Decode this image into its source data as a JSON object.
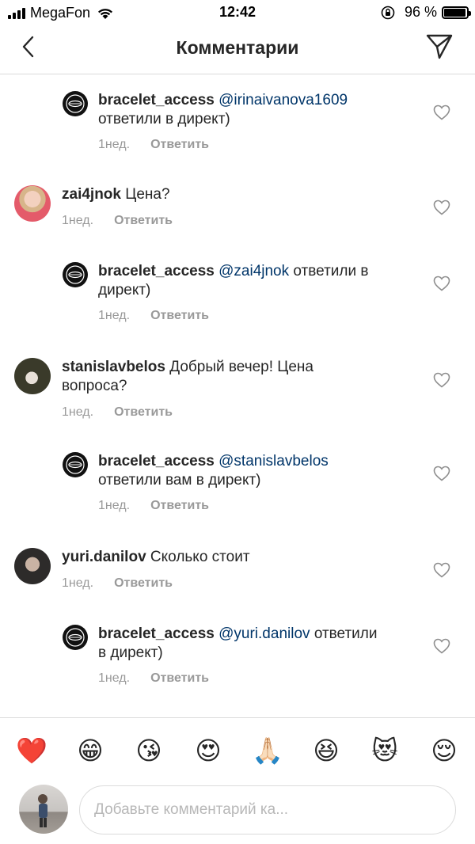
{
  "status_bar": {
    "carrier": "MegaFon",
    "time": "12:42",
    "battery_percent": "96 %",
    "battery_level": 0.96
  },
  "nav": {
    "title": "Комментарии"
  },
  "comments": [
    {
      "username": "bracelet_access",
      "mention": "@irinaivanova1609",
      "text": "ответили в директ)",
      "time": "1нед.",
      "reply_label": "Ответить"
    },
    {
      "username": "zai4jnok",
      "mention": "",
      "text": "Цена?",
      "time": "1нед.",
      "reply_label": "Ответить"
    },
    {
      "username": "bracelet_access",
      "mention": "@zai4jnok",
      "text": "ответили в",
      "text2": "директ)",
      "time": "1нед.",
      "reply_label": "Ответить"
    },
    {
      "username": "stanislavbelos",
      "mention": "",
      "text": "Добрый вечер! Цена",
      "text2": "вопроса?",
      "time": "1нед.",
      "reply_label": "Ответить"
    },
    {
      "username": "bracelet_access",
      "mention": "@stanislavbelos",
      "text": "ответили вам в директ)",
      "time": "1нед.",
      "reply_label": "Ответить"
    },
    {
      "username": "yuri.danilov",
      "mention": "",
      "text": "Сколько стоит",
      "time": "1нед.",
      "reply_label": "Ответить"
    },
    {
      "username": "bracelet_access",
      "mention": "@yuri.danilov",
      "text": "ответили",
      "text2": "в директ)",
      "time": "1нед.",
      "reply_label": "Ответить"
    }
  ],
  "emoji_bar": [
    "❤️",
    "😁",
    "😘",
    "😍",
    "🙏🏻",
    "😆",
    "😻",
    "😌"
  ],
  "composer": {
    "placeholder": "Добавьте комментарий ка..."
  },
  "colors": {
    "text": "#262626",
    "mention": "#003569",
    "meta": "#999999",
    "divider": "#dbdbdb"
  }
}
